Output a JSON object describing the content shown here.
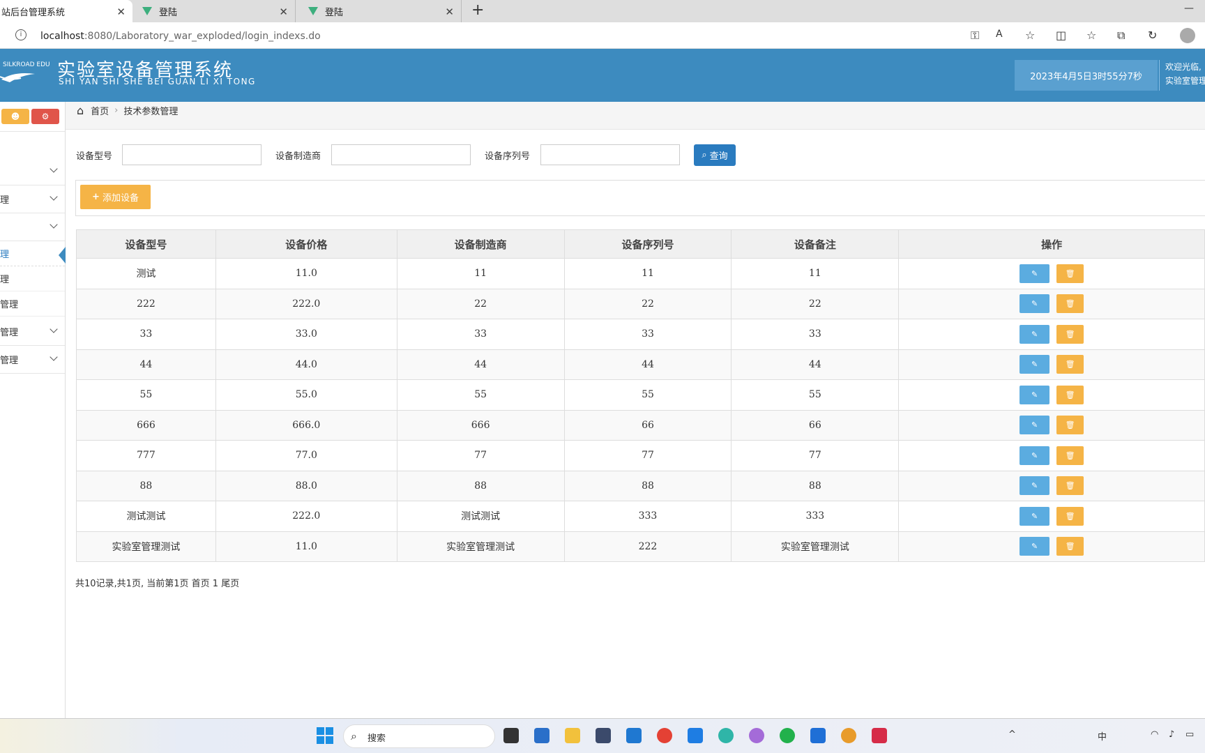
{
  "browser": {
    "tabs": [
      {
        "title": "站后台管理系统",
        "active": true
      },
      {
        "title": "登陆",
        "active": false
      },
      {
        "title": "登陆",
        "active": false
      }
    ],
    "new_tab_label": "+",
    "minimize_label": "—",
    "url_host": "localhost",
    "url_rest": ":8080/Laboratory_war_exploded/login_indexs.do"
  },
  "header": {
    "logo_text": "SILKROAD EDU",
    "title": "实验室设备管理系统",
    "subtitle": "SHI YAN SHI SHE BEI GUAN LI XI TONG",
    "datetime": "2023年4月5日3时55分7秒",
    "welcome_line1": "欢迎光临,",
    "welcome_line2": "实验室管理"
  },
  "sidebar": {
    "items": [
      {
        "label": "",
        "has_chevron": true
      },
      {
        "label": "理",
        "has_chevron": true
      },
      {
        "label": "",
        "has_chevron": true
      }
    ],
    "subitems": [
      {
        "label": "理",
        "active": true
      },
      {
        "label": "理",
        "active": false
      },
      {
        "label": "管理",
        "active": false
      }
    ],
    "groups": [
      {
        "label": "管理",
        "has_chevron": true
      },
      {
        "label": "管理",
        "has_chevron": true
      }
    ]
  },
  "breadcrumb": {
    "home": "首页",
    "separator": "›",
    "current": "技术参数管理"
  },
  "filters": {
    "model_label": "设备型号",
    "manufacturer_label": "设备制造商",
    "serial_label": "设备序列号",
    "model_value": "",
    "manufacturer_value": "",
    "serial_value": "",
    "query_button": "查询"
  },
  "toolbar": {
    "add_button": "添加设备"
  },
  "table": {
    "headers": [
      "设备型号",
      "设备价格",
      "设备制造商",
      "设备序列号",
      "设备备注",
      "操作"
    ],
    "rows": [
      [
        "测试",
        "11.0",
        "11",
        "11",
        "11"
      ],
      [
        "222",
        "222.0",
        "22",
        "22",
        "22"
      ],
      [
        "33",
        "33.0",
        "33",
        "33",
        "33"
      ],
      [
        "44",
        "44.0",
        "44",
        "44",
        "44"
      ],
      [
        "55",
        "55.0",
        "55",
        "55",
        "55"
      ],
      [
        "666",
        "666.0",
        "666",
        "66",
        "66"
      ],
      [
        "777",
        "77.0",
        "77",
        "77",
        "77"
      ],
      [
        "88",
        "88.0",
        "88",
        "88",
        "88"
      ],
      [
        "测试测试",
        "222.0",
        "测试测试",
        "333",
        "333"
      ],
      [
        "实验室管理测试",
        "11.0",
        "实验室管理测试",
        "222",
        "实验室管理测试"
      ]
    ]
  },
  "pager": {
    "summary": "共10记录,共1页, 当前第1页",
    "first": "首页",
    "page": "1",
    "last": "尾页"
  },
  "taskbar": {
    "search_placeholder": "搜索",
    "tray_ime": "中",
    "tray_up": "^"
  },
  "colors": {
    "header_bg": "#3d8bbf",
    "primary_button": "#2a7bbf",
    "edit_button": "#5bace0",
    "warning_button": "#f5b446",
    "delete_header_button": "#e0554a"
  }
}
